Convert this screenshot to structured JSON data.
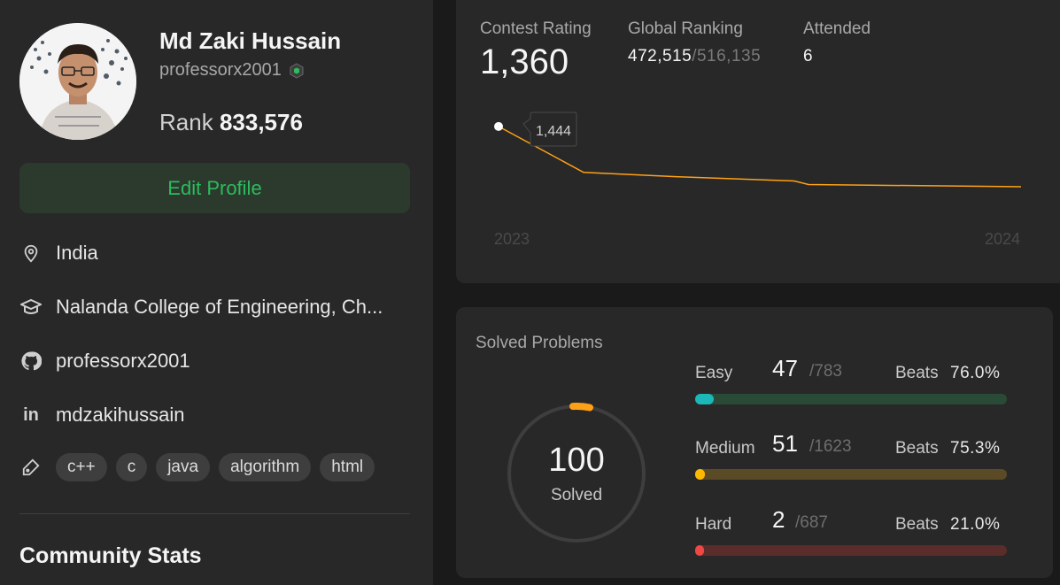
{
  "profile": {
    "name": "Md Zaki Hussain",
    "username": "professorx2001",
    "rank_label": "Rank",
    "rank_value": "833,576",
    "edit_button": "Edit Profile",
    "location": "India",
    "school": "Nalanda College of Engineering, Ch...",
    "github": "professorx2001",
    "linkedin": "mdzakihussain",
    "tags": [
      "c++",
      "c",
      "java",
      "algorithm",
      "html"
    ],
    "community_title": "Community Stats"
  },
  "contest": {
    "rating_label": "Contest Rating",
    "rating_value": "1,360",
    "ranking_label": "Global Ranking",
    "ranking_value": "472,515",
    "ranking_total": "/516,135",
    "attended_label": "Attended",
    "attended_value": "6"
  },
  "chart_data": {
    "type": "line",
    "x": [
      1,
      2,
      3,
      4,
      5,
      6
    ],
    "y": [
      1444,
      1380,
      1374,
      1368,
      1363,
      1360
    ],
    "tooltip": "1,444",
    "tick_labels": [
      "2023",
      "2024"
    ],
    "colors": {
      "line": "#ffa116",
      "point": "#ffffff"
    }
  },
  "solved": {
    "title": "Solved Problems",
    "total": "100",
    "total_label": "Solved",
    "difficulties": [
      {
        "name": "Easy",
        "solved": "47",
        "total": "/783",
        "beats_label": "Beats",
        "beats": "76.0%",
        "fraction": 0.06,
        "color": "#1cb8b8",
        "track": "#2a4a38"
      },
      {
        "name": "Medium",
        "solved": "51",
        "total": "/1623",
        "beats_label": "Beats",
        "beats": "75.3%",
        "fraction": 0.031,
        "color": "#ffb800",
        "track": "#5a4a25"
      },
      {
        "name": "Hard",
        "solved": "2",
        "total": "/687",
        "beats_label": "Beats",
        "beats": "21.0%",
        "fraction": 0.003,
        "color": "#ef4743",
        "track": "#5a2c2a"
      }
    ]
  }
}
